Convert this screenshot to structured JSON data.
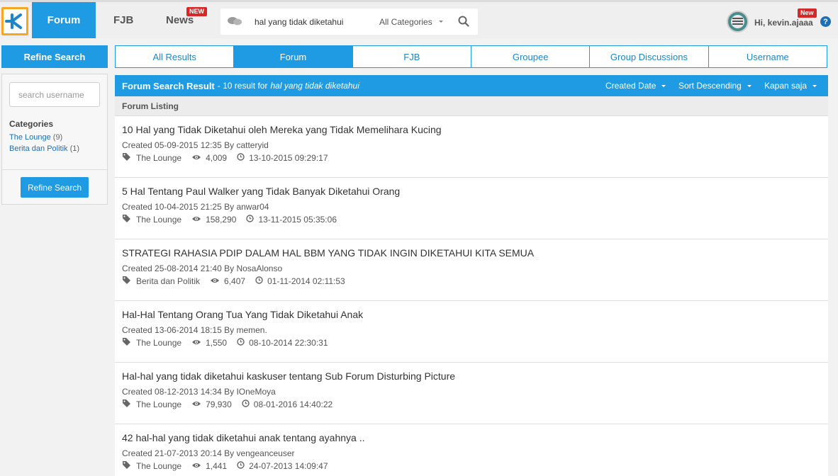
{
  "nav": {
    "logo_icon": "kaskus-logo-icon",
    "forum": "Forum",
    "fjb": "FJB",
    "news": "News",
    "news_badge": "NEW"
  },
  "search": {
    "query": "hal yang tidak diketahui",
    "category": "All Categories"
  },
  "user": {
    "greeting": "Hi, kevin.ajaaa",
    "badge": "New"
  },
  "sidebar": {
    "refine_title": "Refine Search",
    "username_placeholder": "search username",
    "categories_title": "Categories",
    "categories": [
      {
        "name": "The Lounge",
        "count": "(9)"
      },
      {
        "name": "Berita dan Politik",
        "count": "(1)"
      }
    ],
    "refine_button": "Refine Search"
  },
  "tabs": [
    {
      "label": "All Results",
      "active": false
    },
    {
      "label": "Forum",
      "active": true
    },
    {
      "label": "FJB",
      "active": false
    },
    {
      "label": "Groupee",
      "active": false
    },
    {
      "label": "Group Discussions",
      "active": false
    },
    {
      "label": "Username",
      "active": false
    }
  ],
  "results_header": {
    "title": "Forum Search Result",
    "summary": "- 10 result for",
    "query": "hal yang tidak diketahui",
    "sort_by": "Created Date",
    "order": "Sort Descending",
    "time": "Kapan saja"
  },
  "listing_label": "Forum Listing",
  "results": [
    {
      "title": "10 Hal yang Tidak Diketahui oleh Mereka yang Tidak Memelihara Kucing",
      "created": "Created 05-09-2015 12:35 By catteryid",
      "forum": "The Lounge",
      "views": "4,009",
      "last": "13-10-2015 09:29:17"
    },
    {
      "title": "5 Hal Tentang Paul Walker yang Tidak Banyak Diketahui Orang",
      "created": "Created 10-04-2015 21:25 By anwar04",
      "forum": "The Lounge",
      "views": "158,290",
      "last": "13-11-2015 05:35:06"
    },
    {
      "title": "STRATEGI RAHASIA PDIP DALAM HAL BBM YANG TIDAK INGIN DIKETAHUI KITA SEMUA",
      "created": "Created 25-08-2014 21:40 By NosaAlonso",
      "forum": "Berita dan Politik",
      "views": "6,407",
      "last": "01-11-2014 02:11:53"
    },
    {
      "title": "Hal-Hal Tentang Orang Tua Yang Tidak Diketahui Anak",
      "created": "Created 13-06-2014 18:15 By memen.",
      "forum": "The Lounge",
      "views": "1,550",
      "last": "08-10-2014 22:30:31"
    },
    {
      "title": "Hal-hal yang tidak diketahui kaskuser tentang Sub Forum Disturbing Picture",
      "created": "Created 08-12-2013 14:34 By IOneMoya",
      "forum": "The Lounge",
      "views": "79,930",
      "last": "08-01-2016 14:40:22"
    },
    {
      "title": "42 hal-hal yang tidak diketahui anak tentang ayahnya ..",
      "created": "Created 21-07-2013 20:14 By vengeanceuser",
      "forum": "The Lounge",
      "views": "1,441",
      "last": "24-07-2013 14:09:47"
    }
  ],
  "colors": {
    "accent": "#1e9be2",
    "logo_border": "#f6a623",
    "badge": "#d62828"
  },
  "icons": {
    "forum": "tag-icon",
    "views": "eye-icon",
    "last_post": "clock-icon"
  }
}
